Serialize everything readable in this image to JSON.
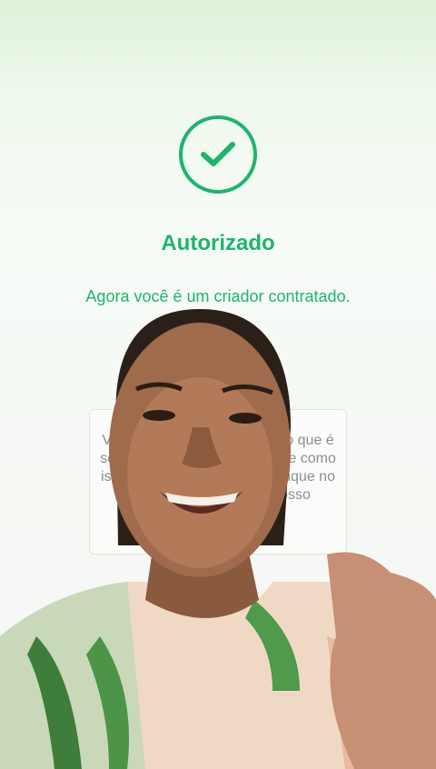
{
  "status": {
    "icon": "check-icon",
    "title": "Autorizado",
    "message": "Agora você é um criador contratado."
  },
  "card": {
    "text": "Veja abaixo um vídeo sobre o que é ser um criador do nosso app e como isso ajuda você a receber. Clique no botão e saiba mais no nosso"
  },
  "colors": {
    "accent": "#1eb46c",
    "background_top": "#dff2da",
    "card_text": "#8a8f8a"
  }
}
